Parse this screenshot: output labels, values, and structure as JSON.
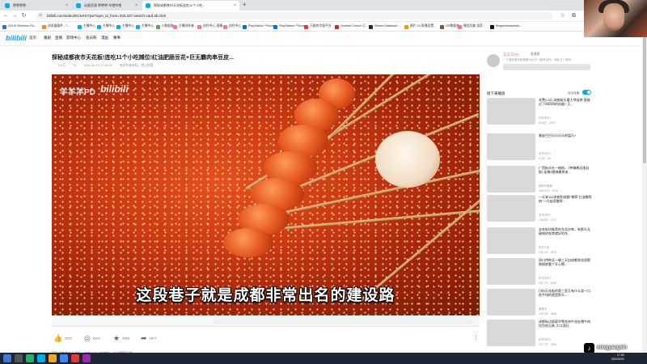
{
  "browser": {
    "tabs": [
      {
        "label": "咿咿咿咿 - "
      },
      {
        "label": "动画资源 咿咿咿 哔哩哔哩"
      },
      {
        "label": "探秘成都夜市天花板连吃11个小吃..."
      }
    ],
    "url": "bilibili.com/video/BV1eHz7pw?spm_id_from=333.337.search-card.all.click",
    "bookmarks": [
      "ASUS Wireless Ro...",
      "浏览器插件 - 7...",
      "主播中心",
      "主播中心",
      "主播中心",
      "主播中心",
      "3.数据查",
      "主播创作者...",
      "创作中心-直播...",
      "创作中心",
      "PlayStation™Store...",
      "PlayStation™Store...",
      "万能的字幕平台",
      "Humble Choice 订...",
      "Steam Database ...",
      "图片.10.直播设置...",
      "GE数据查",
      "微信回复 语音...",
      "thegamesawards..."
    ]
  },
  "page": {
    "logo": "bilibili",
    "nav": [
      "首页",
      "番剧",
      "直播",
      "游戏中心",
      "会员购",
      "漫画",
      "赛事"
    ],
    "video_title": "探秘成都夜市天花板!连吃11个小吃摊位!红油肥肠豆花+巨无霸肉串豆皮...",
    "meta": [
      "3.6万",
      "74",
      "2024-08-19 17:00:00",
      "未经作者授权，禁止转载"
    ],
    "watermark_cn": "羊羊羊PD",
    "watermark_logo": "bilibili",
    "subtitle": "这段巷子就是成都非常出名的建设路",
    "actions": [
      {
        "icon": "thumb-up-icon",
        "glyph": "👍",
        "count": "5372"
      },
      {
        "icon": "coin-icon",
        "glyph": "◎",
        "count": "8102"
      },
      {
        "icon": "star-icon",
        "glyph": "★",
        "count": "4563"
      },
      {
        "icon": "share-icon",
        "glyph": "➦",
        "count": "4577"
      }
    ],
    "more_glyph": "⋮",
    "description": "探秘成都夜市天花板，连吃11个小吃摊位，红油肥肠豆花..."
  },
  "up": {
    "name": "羊羊羊PD",
    "msg": "发消息",
    "bio": "一个爱吃爱玩的成都小伙子（商务合作，请私了）商务..."
  },
  "sidebar": {
    "next_label": "接下来播放",
    "autoplay_label": "自动连播",
    "recs": [
      {
        "title": "花费2.8元,成都街头看大爷烧烤,竟能过了四四四的机器? 又...",
        "up": "羊羊羊PD",
        "stats": "80.6万   2376"
      },
      {
        "title": "雅安巴巴乐乐乐乐的猛乐?",
        "up": "羊羊羊PD",
        "stats": "3.0万   25"
      },
      {
        "title": "广西街头社一碗粉，7种辣酱无限自助! 连辣3根辣酱原来...",
        "up": "美拍可美美",
        "stats": "1800.6万   3278"
      },
      {
        "title": "一天来100多趟的成都\"猪蹄\"红油猪蹄肉\"一口连续猪蹄\"...",
        "up": "羊羊羊PD",
        "stats": "138.8万   1071"
      },
      {
        "title": "去吃街坊推荐的东北炒串，有那么无敌肉的吃串就好的东...",
        "up": "吃货飞天",
        "stats": "761.1万   2873"
      },
      {
        "title": "四川特种兵一餐三天自成都到花卤肥肠锅底看个开心哦...",
        "up": "羊羊羊PD",
        "stats": "251.1万   6055"
      },
      {
        "title": "日料天花板的第三家又有什么卖一口吃牛排的就是那么...",
        "up": "美食羊",
        "stats": "149.9万   4808"
      },
      {
        "title": "成都街边超豪华雪花肉牛花肚猪牛肉包包吃出来-大口凌肚...",
        "up": "羊羊羊PD",
        "stats": "137.7万   2594"
      }
    ]
  },
  "overlay": {
    "tiktok_glyph": "♪",
    "tiktok_name": "mingyangxin"
  },
  "tray": {
    "time": "17:45",
    "date": "2024/9/29"
  }
}
